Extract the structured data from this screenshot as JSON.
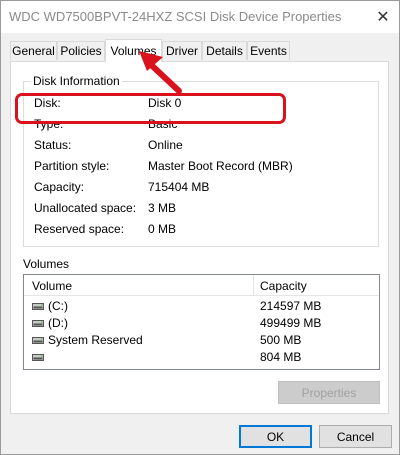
{
  "window": {
    "title": "WDC WD7500BPVT-24HXZ SCSI Disk Device Properties",
    "close_glyph": "✕"
  },
  "tabs": [
    {
      "label": "General"
    },
    {
      "label": "Policies"
    },
    {
      "label": "Volumes"
    },
    {
      "label": "Driver"
    },
    {
      "label": "Details"
    },
    {
      "label": "Events"
    }
  ],
  "active_tab": "Volumes",
  "disk_info": {
    "legend": "Disk Information",
    "rows": [
      {
        "label": "Disk:",
        "value": "Disk 0"
      },
      {
        "label": "Type:",
        "value": "Basic"
      },
      {
        "label": "Status:",
        "value": "Online"
      },
      {
        "label": "Partition style:",
        "value": "Master Boot Record (MBR)"
      },
      {
        "label": "Capacity:",
        "value": "715404 MB"
      },
      {
        "label": "Unallocated space:",
        "value": "3 MB"
      },
      {
        "label": "Reserved space:",
        "value": "0 MB"
      }
    ]
  },
  "volumes": {
    "label": "Volumes",
    "columns": [
      "Volume",
      "Capacity"
    ],
    "rows": [
      {
        "name": "(C:)",
        "capacity": "214597 MB"
      },
      {
        "name": "(D:)",
        "capacity": "499499 MB"
      },
      {
        "name": "System Reserved",
        "capacity": "500 MB"
      },
      {
        "name": "",
        "capacity": "804 MB"
      }
    ],
    "properties_button": "Properties"
  },
  "buttons": {
    "ok": "OK",
    "cancel": "Cancel"
  },
  "annotation": {
    "highlight_color": "#d9121d"
  }
}
